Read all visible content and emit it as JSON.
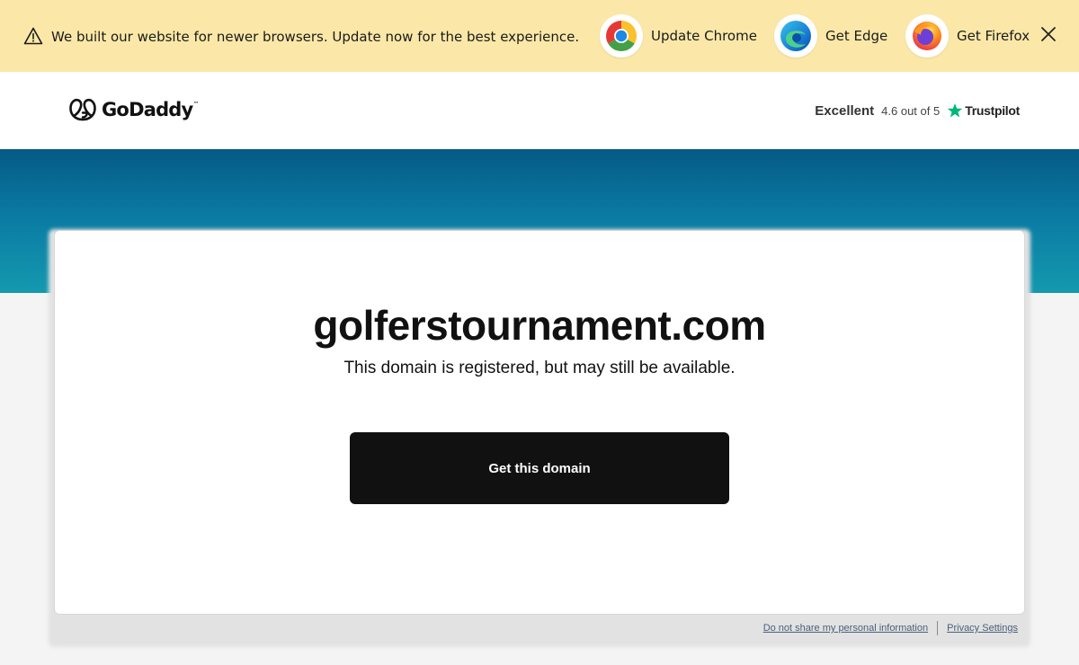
{
  "banner": {
    "message": "We built our website for newer browsers. Update now for the best experience.",
    "browsers": [
      {
        "label": "Update Chrome",
        "icon": "chrome-icon"
      },
      {
        "label": "Get Edge",
        "icon": "edge-icon"
      },
      {
        "label": "Get Firefox",
        "icon": "firefox-icon"
      }
    ],
    "close_icon": "close-icon",
    "background": "#fbe8a8"
  },
  "header": {
    "logo_text": "GoDaddy",
    "rating_word": "Excellent",
    "rating_score": "4.6 out of 5",
    "trustpilot": "Trustpilot",
    "trustpilot_color": "#00b67a"
  },
  "main": {
    "domain": "golferstournament.com",
    "subtitle": "This domain is registered, but may still be available.",
    "cta_label": "Get this domain"
  },
  "footer": {
    "links": [
      "Do not share my personal information",
      "Privacy Settings"
    ]
  },
  "colors": {
    "band_top": "#055a84",
    "band_bottom": "#1499ae",
    "cta": "#111111"
  }
}
